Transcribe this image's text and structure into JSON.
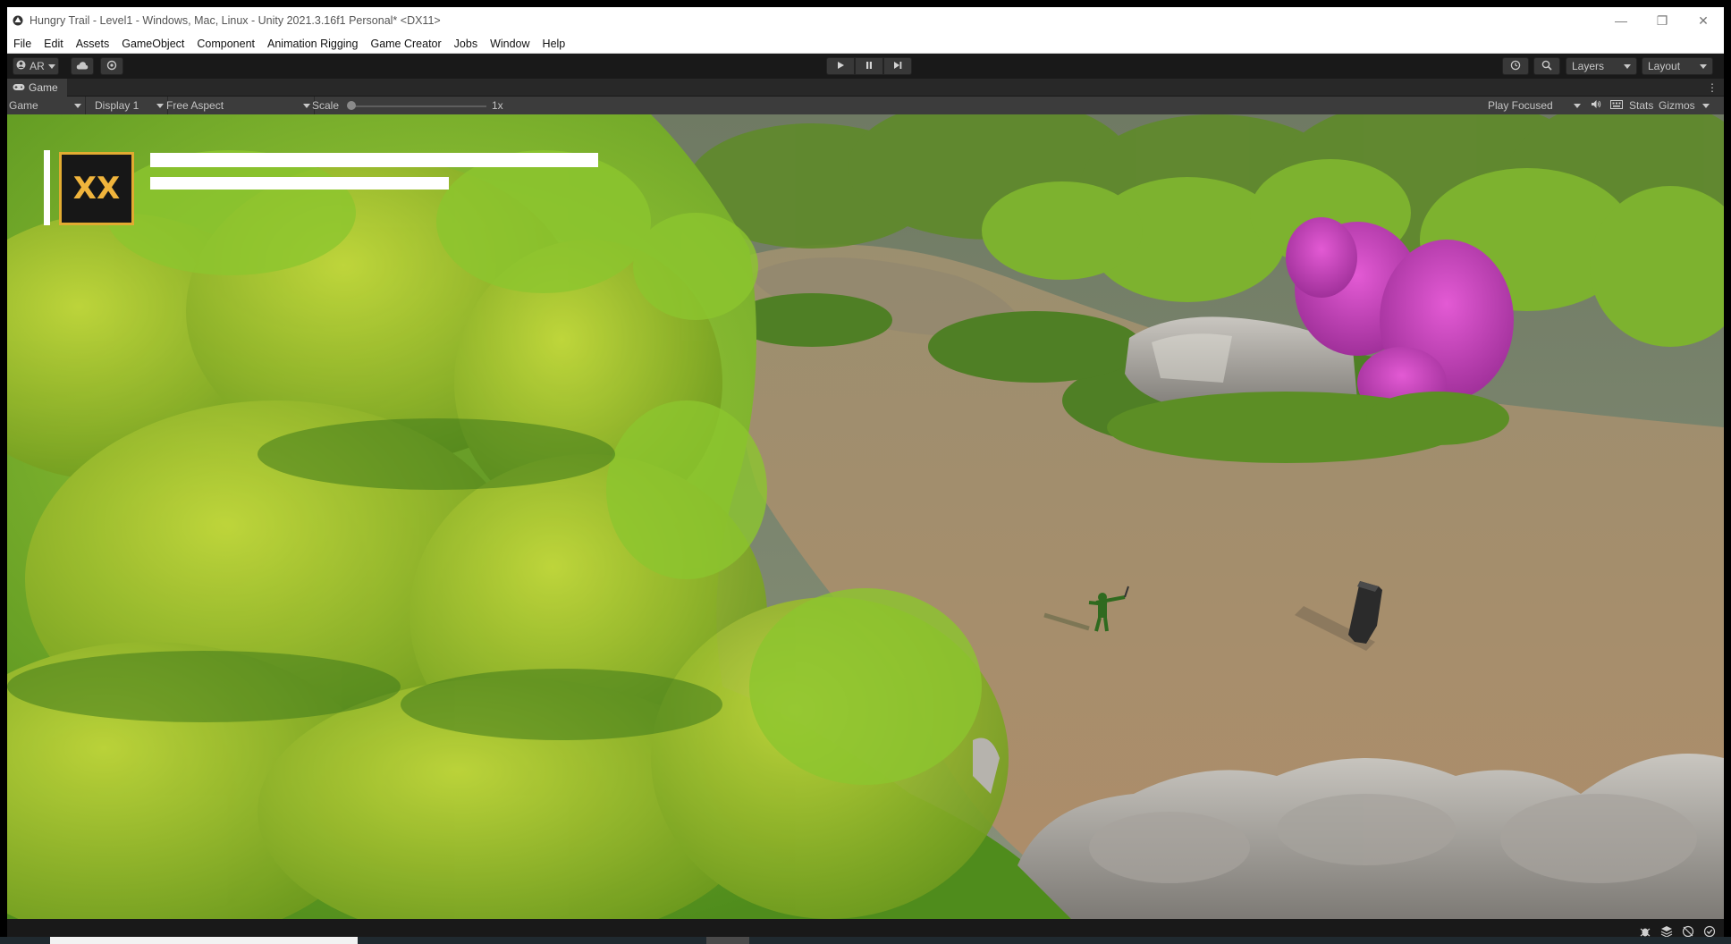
{
  "window": {
    "title": "Hungry Trail - Level1 - Windows, Mac, Linux - Unity 2021.3.16f1 Personal* <DX11>",
    "minimize": "—",
    "restore": "❐",
    "close": "✕"
  },
  "menu": {
    "items": [
      "File",
      "Edit",
      "Assets",
      "GameObject",
      "Component",
      "Animation Rigging",
      "Game Creator",
      "Jobs",
      "Window",
      "Help"
    ]
  },
  "toolbar": {
    "account_label": "AR",
    "layers_label": "Layers",
    "layout_label": "Layout"
  },
  "game_tab": {
    "label": "Game"
  },
  "game_toolbar": {
    "view_mode": "Game",
    "display": "Display 1",
    "aspect": "Free Aspect",
    "scale_label": "Scale",
    "scale_value": "1x",
    "scale_level": 0,
    "play_mode": "Play Focused",
    "stats_label": "Stats",
    "gizmos_label": "Gizmos"
  },
  "hud": {
    "badge_text": "XX"
  },
  "colors": {
    "accent_gold": "#e2ab31",
    "editor_dark": "#191919",
    "panel": "#3c3c3c"
  }
}
